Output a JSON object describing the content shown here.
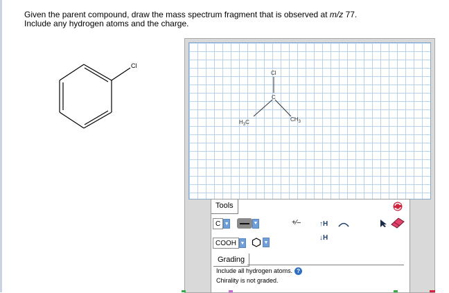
{
  "question": {
    "line1_prefix": "Given the parent compound, draw the mass spectrum fragment that is observed at ",
    "line1_mz": "m/z",
    "line1_value": " 77.",
    "line2": "Include any hydrogen atoms and the charge."
  },
  "parent_compound": {
    "substituent_label": "Cl"
  },
  "sketch": {
    "atoms": {
      "top": "Cl",
      "center": "C",
      "left_label": "H",
      "left_sub": "3",
      "left_tail": "C",
      "right_main": "CH",
      "right_sub": "3"
    }
  },
  "toolbar": {
    "tools_tab": "Tools",
    "element_value": "C",
    "group_value": "COOH",
    "charge_label": "+⁄–",
    "add_h_label": "↑H",
    "remove_h_label": "↓H"
  },
  "grading": {
    "tab_label": "Grading",
    "line1": "Include all hydrogen atoms.",
    "line2": "Chirality is not graded.",
    "help_glyph": "?"
  },
  "colors": {
    "grid": "#b7d2ee",
    "dropdown": "#6f9fd8",
    "eraser": "#e0426a",
    "clear": "#d0233e"
  }
}
